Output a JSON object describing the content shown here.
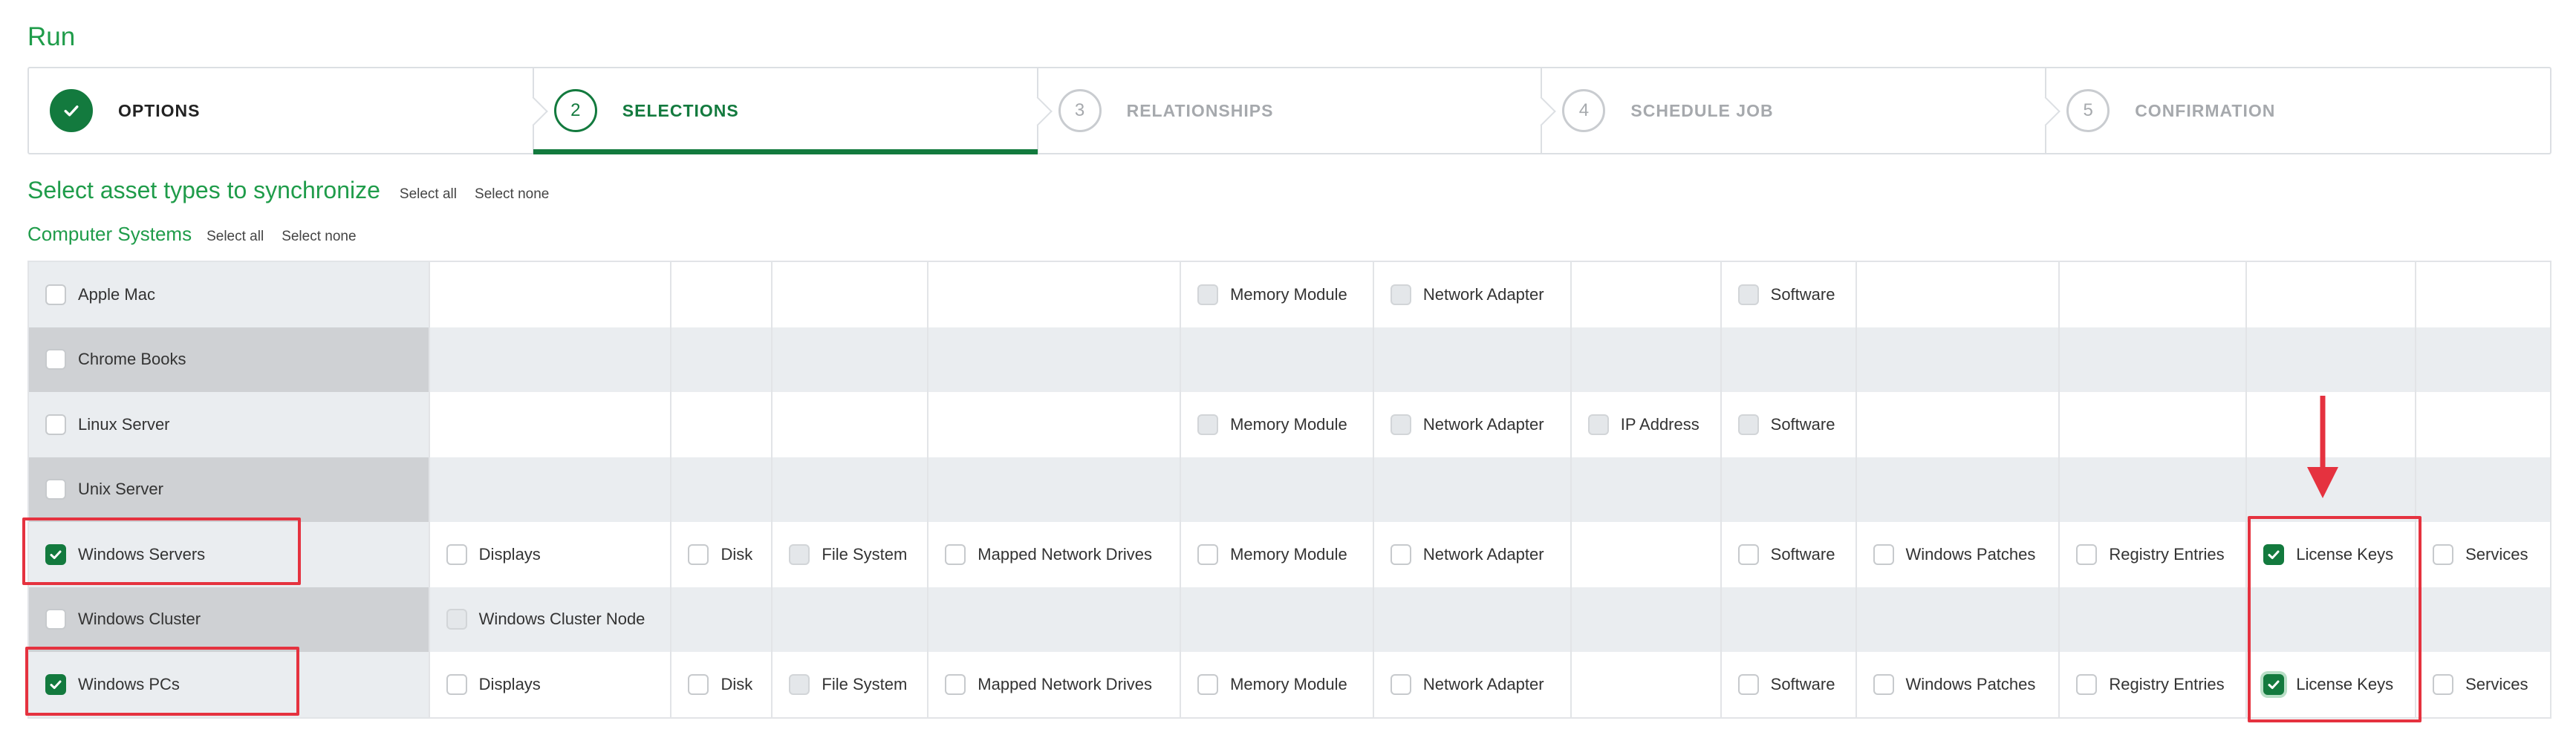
{
  "page": {
    "title": "Run"
  },
  "stepper": [
    {
      "number": "",
      "label": "OPTIONS",
      "state": "done"
    },
    {
      "number": "2",
      "label": "SELECTIONS",
      "state": "active"
    },
    {
      "number": "3",
      "label": "RELATIONSHIPS",
      "state": "todo"
    },
    {
      "number": "4",
      "label": "SCHEDULE JOB",
      "state": "todo"
    },
    {
      "number": "5",
      "label": "CONFIRMATION",
      "state": "todo"
    }
  ],
  "section": {
    "title": "Select asset types to synchronize",
    "select_all": "Select all",
    "select_none": "Select none"
  },
  "group": {
    "title": "Computer Systems",
    "select_all": "Select all",
    "select_none": "Select none"
  },
  "colors": {
    "accent": "#1f9c4a",
    "accent_dark": "#137a3e",
    "highlight": "#e5323f"
  },
  "grid": {
    "columns": 13,
    "rows": [
      {
        "label": "Apple Mac",
        "checked": false,
        "options": [
          null,
          null,
          null,
          null,
          {
            "label": "Memory Module",
            "state": "disabled"
          },
          {
            "label": "Network Adapter",
            "state": "disabled"
          },
          null,
          {
            "label": "Software",
            "state": "disabled"
          },
          null,
          null,
          null,
          null
        ]
      },
      {
        "label": "Chrome Books",
        "checked": false,
        "options": [
          null,
          null,
          null,
          null,
          null,
          null,
          null,
          null,
          null,
          null,
          null,
          null
        ]
      },
      {
        "label": "Linux Server",
        "checked": false,
        "options": [
          null,
          null,
          null,
          null,
          {
            "label": "Memory Module",
            "state": "disabled"
          },
          {
            "label": "Network Adapter",
            "state": "disabled"
          },
          {
            "label": "IP Address",
            "state": "disabled"
          },
          {
            "label": "Software",
            "state": "disabled"
          },
          null,
          null,
          null,
          null
        ]
      },
      {
        "label": "Unix Server",
        "checked": false,
        "options": [
          null,
          null,
          null,
          null,
          null,
          null,
          null,
          null,
          null,
          null,
          null,
          null
        ]
      },
      {
        "label": "Windows Servers",
        "checked": true,
        "options": [
          {
            "label": "Displays",
            "state": "unchecked"
          },
          {
            "label": "Disk",
            "state": "unchecked"
          },
          {
            "label": "File System",
            "state": "disabled"
          },
          {
            "label": "Mapped Network Drives",
            "state": "unchecked"
          },
          {
            "label": "Memory Module",
            "state": "unchecked"
          },
          {
            "label": "Network Adapter",
            "state": "unchecked"
          },
          null,
          {
            "label": "Software",
            "state": "unchecked"
          },
          {
            "label": "Windows Patches",
            "state": "unchecked"
          },
          {
            "label": "Registry Entries",
            "state": "unchecked"
          },
          {
            "label": "License Keys",
            "state": "checked"
          },
          {
            "label": "Services",
            "state": "unchecked"
          }
        ]
      },
      {
        "label": "Windows Cluster",
        "checked": false,
        "options": [
          {
            "label": "Windows Cluster Node",
            "state": "disabled"
          },
          null,
          null,
          null,
          null,
          null,
          null,
          null,
          null,
          null,
          null,
          null
        ]
      },
      {
        "label": "Windows PCs",
        "checked": true,
        "options": [
          {
            "label": "Displays",
            "state": "unchecked"
          },
          {
            "label": "Disk",
            "state": "unchecked"
          },
          {
            "label": "File System",
            "state": "disabled"
          },
          {
            "label": "Mapped Network Drives",
            "state": "unchecked"
          },
          {
            "label": "Memory Module",
            "state": "unchecked"
          },
          {
            "label": "Network Adapter",
            "state": "unchecked"
          },
          null,
          {
            "label": "Software",
            "state": "unchecked"
          },
          {
            "label": "Windows Patches",
            "state": "unchecked"
          },
          {
            "label": "Registry Entries",
            "state": "unchecked"
          },
          {
            "label": "License Keys",
            "state": "checked-focused"
          },
          {
            "label": "Services",
            "state": "unchecked"
          }
        ]
      }
    ]
  }
}
